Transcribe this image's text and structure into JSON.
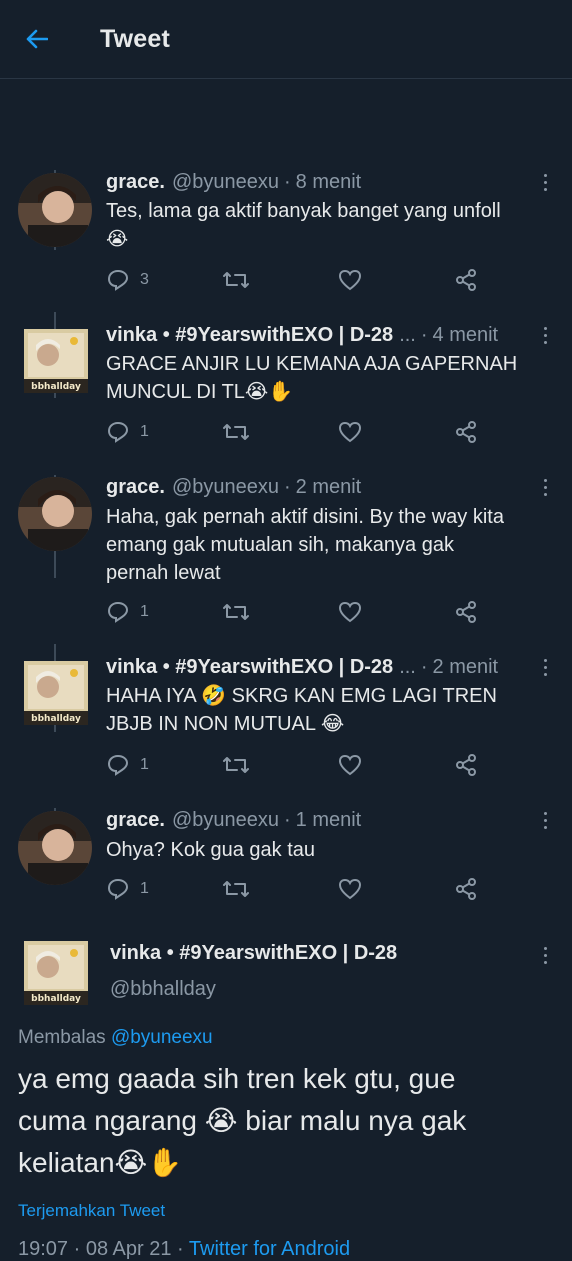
{
  "header": {
    "title": "Tweet"
  },
  "replies": [
    {
      "name": "grace.",
      "handle": "@byuneexu",
      "time": "8 menit",
      "text_lines": [
        "Tes, lama ga aktif banyak banget yang unfoll",
        "😭"
      ],
      "reply_count": "3"
    },
    {
      "name": "vinka • #9YearswithEXO | D-28",
      "ellipsis": "...",
      "time": "4 menit",
      "text_lines": [
        "GRACE ANJIR LU KEMANA AJA GAPERNAH",
        "MUNCUL DI TL😭✋"
      ],
      "reply_count": "1"
    },
    {
      "name": "grace.",
      "handle": "@byuneexu",
      "time": "2 menit",
      "text_lines": [
        "Haha, gak pernah aktif disini. By the way kita",
        "emang gak mutualan sih, makanya gak",
        "pernah lewat"
      ],
      "reply_count": "1"
    },
    {
      "name": "vinka • #9YearswithEXO | D-28",
      "ellipsis": "...",
      "time": "2 menit",
      "text_lines": [
        "HAHA IYA 🤣 SKRG KAN EMG LAGI TREN",
        "JBJB IN NON MUTUAL 😂"
      ],
      "reply_count": "1"
    },
    {
      "name": "grace.",
      "handle": "@byuneexu",
      "time": "1 menit",
      "text_lines": [
        "Ohya? Kok gua gak tau"
      ],
      "reply_count": "1"
    }
  ],
  "main_tweet": {
    "name": "vinka • #9YearswithEXO | D-28",
    "handle": "@bbhallday",
    "replying_prefix": "Membalas",
    "replying_to": "@byuneexu",
    "text_lines": [
      "ya emg gaada sih tren kek gtu, gue",
      "cuma ngarang 😭 biar malu nya gak",
      "keliatan😭✋"
    ],
    "translate": "Terjemahkan Tweet",
    "time": "19:07",
    "date": "08 Apr 21",
    "source": "Twitter for Android"
  },
  "avatar_text": "bbhallday",
  "colors": {
    "background": "#151f2b",
    "accent": "#1d9bf0",
    "muted": "#8b98a5",
    "text": "#e7e9ea"
  }
}
